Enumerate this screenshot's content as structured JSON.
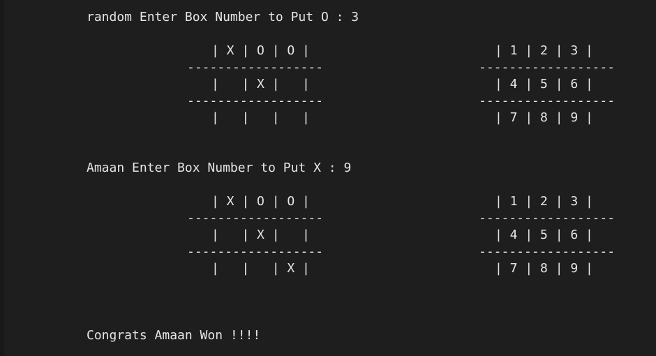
{
  "terminal": {
    "lines": [
      {
        "text": "random Enter Box Number to Put O : 3"
      },
      {
        "text": "| X | O | O |"
      },
      {
        "text": "------------------"
      },
      {
        "text": "|   | X |   |"
      },
      {
        "text": "------------------"
      },
      {
        "text": "|   |   |   |"
      },
      {
        "text": "| 1 | 2 | 3 |"
      },
      {
        "text": "------------------"
      },
      {
        "text": "| 4 | 5 | 6 |"
      },
      {
        "text": "------------------"
      },
      {
        "text": "| 7 | 8 | 9 |"
      },
      {
        "text": "Amaan Enter Box Number to Put X : 9"
      },
      {
        "text": "| X | O | O |"
      },
      {
        "text": "------------------"
      },
      {
        "text": "|   | X |   |"
      },
      {
        "text": "------------------"
      },
      {
        "text": "|   |   | X |"
      },
      {
        "text": "| 1 | 2 | 3 |"
      },
      {
        "text": "------------------"
      },
      {
        "text": "| 4 | 5 | 6 |"
      },
      {
        "text": "------------------"
      },
      {
        "text": "| 7 | 8 | 9 |"
      },
      {
        "text": "Congrats Amaan Won !!!!"
      }
    ]
  }
}
